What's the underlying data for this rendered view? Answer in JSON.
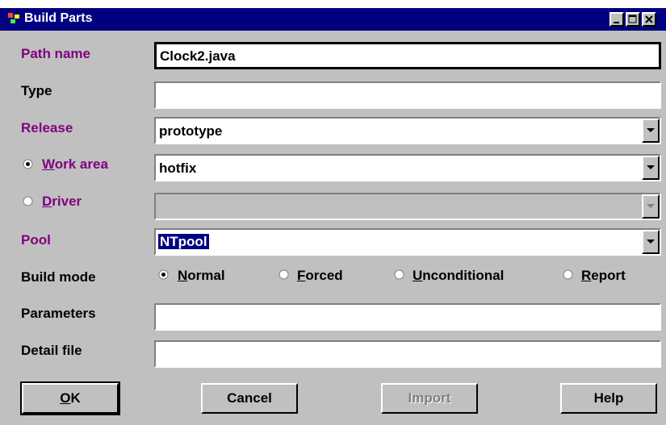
{
  "window": {
    "title": "Build Parts"
  },
  "form": {
    "path_name": {
      "label": "Path name",
      "value": "Clock2.java"
    },
    "type": {
      "label": "Type",
      "value": ""
    },
    "release": {
      "label": "Release",
      "value": "prototype"
    },
    "work_area": {
      "label": "Work area",
      "value": "hotfix",
      "selected": true
    },
    "driver": {
      "label": "Driver",
      "value": "",
      "selected": false,
      "disabled": true
    },
    "pool": {
      "label": "Pool",
      "value": "NTpool"
    },
    "build_mode": {
      "label": "Build mode",
      "options": [
        {
          "label": "Normal",
          "selected": true
        },
        {
          "label": "Forced",
          "selected": false
        },
        {
          "label": "Unconditional",
          "selected": false
        },
        {
          "label": "Report",
          "selected": false
        }
      ]
    },
    "parameters": {
      "label": "Parameters",
      "value": ""
    },
    "detail_file": {
      "label": "Detail file",
      "value": ""
    }
  },
  "buttons": {
    "ok": "OK",
    "cancel": "Cancel",
    "import": "Import",
    "help": "Help"
  },
  "colors": {
    "title_bar": "#000080",
    "label_accent": "#800080",
    "face": "#c0c0c0"
  }
}
